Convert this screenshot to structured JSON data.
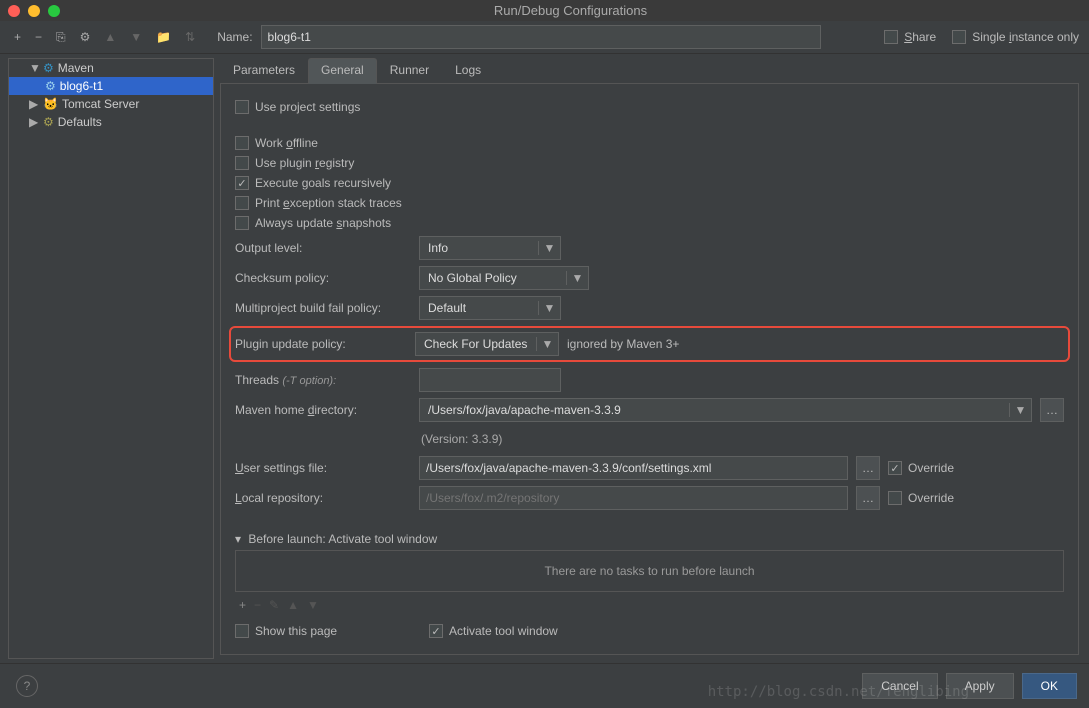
{
  "window": {
    "title": "Run/Debug Configurations"
  },
  "toolbar": {
    "name_label": "Name:",
    "name_value": "blog6-t1",
    "share_label": "Share",
    "single_instance_label": "Single instance only"
  },
  "tree": {
    "maven": "Maven",
    "blog": "blog6-t1",
    "tomcat": "Tomcat Server",
    "defaults": "Defaults"
  },
  "tabs": {
    "parameters": "Parameters",
    "general": "General",
    "runner": "Runner",
    "logs": "Logs"
  },
  "form": {
    "use_project_settings": "Use project settings",
    "work_offline": "Work offline",
    "use_plugin_registry": "Use plugin registry",
    "execute_goals": "Execute goals recursively",
    "print_exception": "Print exception stack traces",
    "always_update": "Always update snapshots",
    "output_level_label": "Output level:",
    "output_level_value": "Info",
    "checksum_label": "Checksum policy:",
    "checksum_value": "No Global Policy",
    "multiproject_label": "Multiproject build fail policy:",
    "multiproject_value": "Default",
    "plugin_update_label": "Plugin update policy:",
    "plugin_update_value": "Check For Updates",
    "plugin_update_note": "ignored by Maven 3+",
    "threads_label": "Threads ",
    "threads_note": "(-T option):",
    "maven_home_label": "Maven home directory:",
    "maven_home_value": "/Users/fox/java/apache-maven-3.3.9",
    "version": "(Version: 3.3.9)",
    "user_settings_label": "User settings file:",
    "user_settings_value": "/Users/fox/java/apache-maven-3.3.9/conf/settings.xml",
    "local_repo_label": "Local repository:",
    "local_repo_placeholder": "/Users/fox/.m2/repository",
    "override": "Override"
  },
  "before_launch": {
    "title": "Before launch: Activate tool window",
    "empty": "There are no tasks to run before launch",
    "show_page": "Show this page",
    "activate": "Activate tool window"
  },
  "footer": {
    "cancel": "Cancel",
    "apply": "Apply",
    "ok": "OK"
  },
  "watermark": "http://blog.csdn.net/fenglibing"
}
